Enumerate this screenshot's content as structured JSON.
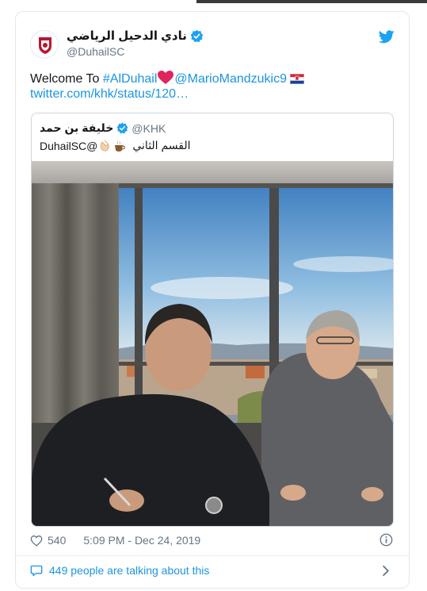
{
  "tweet": {
    "author_name": "نادي الدحيل الرياضي",
    "author_handle": "@DuhailSC",
    "text_prefix": "Welcome To ",
    "hashtag": "#AlDuhail",
    "mention": "@MarioMandzukic9",
    "link": "twitter.com/khk/status/120…",
    "likes": "540",
    "timestamp": "5:09 PM - Dec 24, 2019",
    "talking": "449 people are talking about this"
  },
  "quoted": {
    "author_name": "خليفة بن حمد",
    "author_handle": "@KHK",
    "text_arabic": "القسم الثاني",
    "text_mention": "DuhailSC@"
  },
  "icons": {
    "avatar": "club-crest-icon",
    "verified": "verified-badge-icon",
    "platform": "twitter-bird-icon",
    "like": "heart-outline-icon",
    "info": "info-icon",
    "talking": "speech-bubble-icon",
    "more": "chevron-right-icon"
  },
  "colors": {
    "link": "#1b95e0",
    "text": "#14171a",
    "secondary": "#657786",
    "verified": "#1da1f2",
    "heart_emoji": "#e0245e"
  }
}
